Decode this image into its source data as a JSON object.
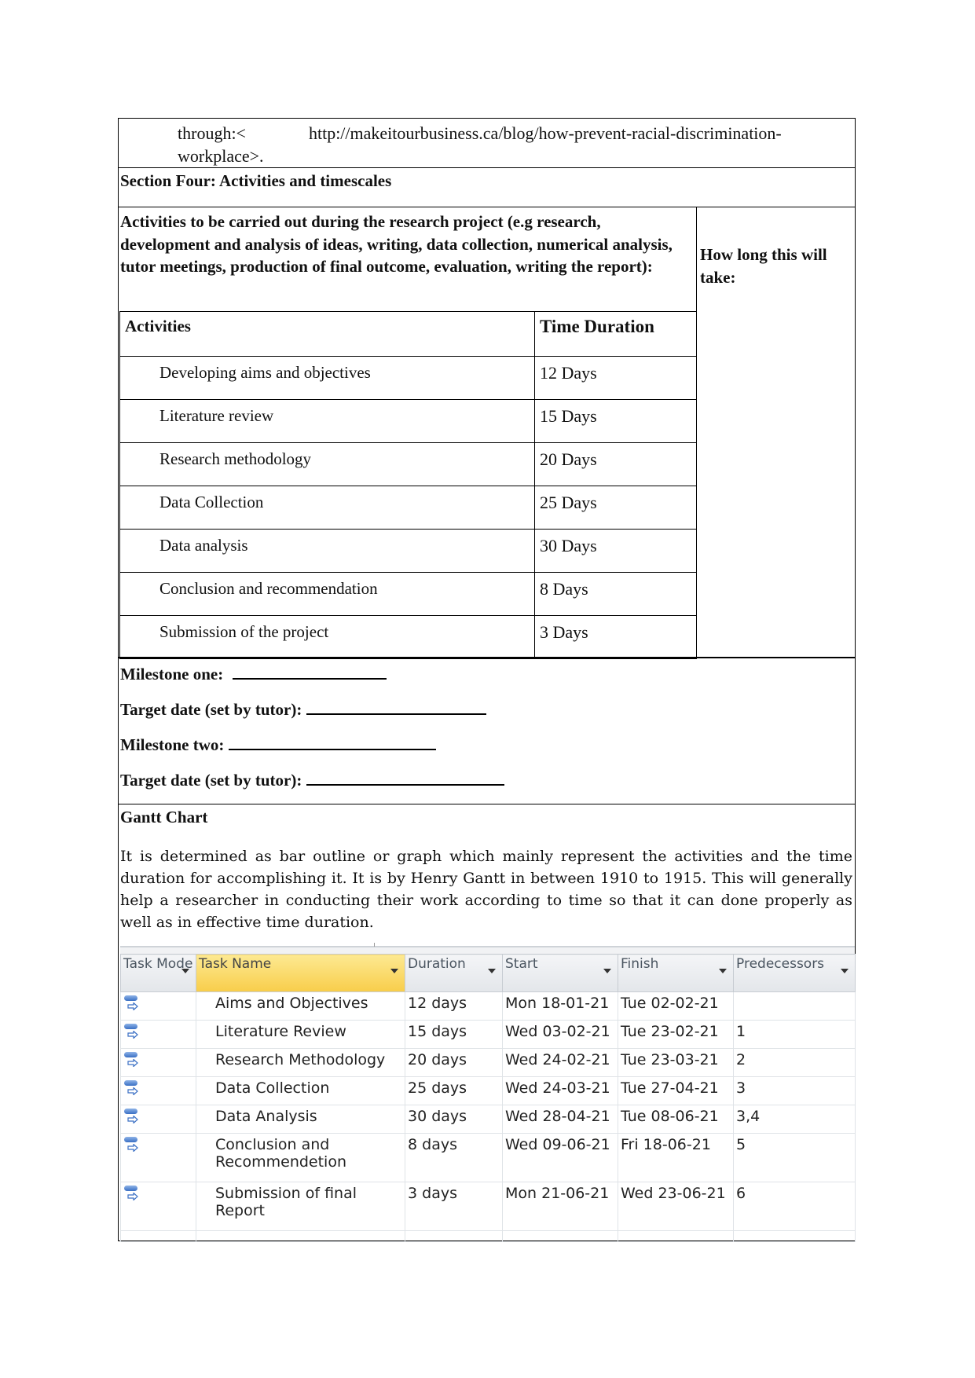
{
  "reference": {
    "prefix": "through:<",
    "url": "http://makeitourbusiness.ca/blog/how-prevent-racial-discrimination-",
    "suffix": "workplace>."
  },
  "section_title": "Section Four: Activities and timescales",
  "activities_block": {
    "intro": "Activities to be carried out during the research project (e.g research, development and analysis of ideas, writing, data collection, numerical analysis, tutor meetings, production of final outcome, evaluation, writing the report):",
    "how_long_label": "How long this will take:",
    "table": {
      "headers": [
        "Activities",
        "Time Duration"
      ],
      "rows": [
        {
          "activity": "Developing aims and objectives",
          "duration": "12 Days"
        },
        {
          "activity": "Literature review",
          "duration": "15 Days"
        },
        {
          "activity": "Research methodology",
          "duration": "20 Days"
        },
        {
          "activity": "Data Collection",
          "duration": "25 Days"
        },
        {
          "activity": "Data analysis",
          "duration": "30 Days"
        },
        {
          "activity": "Conclusion and recommendation",
          "duration": "8 Days"
        },
        {
          "activity": "Submission of the project",
          "duration": "3 Days"
        }
      ]
    }
  },
  "milestones": [
    {
      "label": "Milestone one:",
      "value": ""
    },
    {
      "label": "Target date (set by tutor):",
      "value": ""
    },
    {
      "label": "Milestone two:",
      "value": ""
    },
    {
      "label": "Target date (set by tutor):",
      "value": ""
    }
  ],
  "gantt": {
    "title": "Gantt Chart",
    "paragraph": " It is determined as bar outline or graph which mainly represent the activities and the time duration for accomplishing it. It is by Henry Gantt in between 1910 to 1915. This will generally help a researcher in conducting their work according to time so that it can done properly as well as in effective time duration.",
    "table": {
      "headers": [
        "Task Mode",
        "Task Name",
        "Duration",
        "Start",
        "Finish",
        "Predecessors"
      ],
      "selected_header": "Task Name",
      "task_mode_icon": "auto-scheduled-task-icon",
      "colors": {
        "selected_header": "#f8cd4a",
        "header": "#e3e6ea",
        "icon": "#3a6fc4"
      },
      "rows": [
        {
          "name": "Aims and Objectives",
          "duration": "12 days",
          "start": "Mon 18-01-21",
          "finish": "Tue 02-02-21",
          "predecessors": ""
        },
        {
          "name": "Literature Review",
          "duration": "15 days",
          "start": "Wed 03-02-21",
          "finish": "Tue 23-02-21",
          "predecessors": "1"
        },
        {
          "name": "Research Methodology",
          "duration": "20 days",
          "start": "Wed 24-02-21",
          "finish": "Tue 23-03-21",
          "predecessors": "2"
        },
        {
          "name": "Data Collection",
          "duration": "25 days",
          "start": "Wed 24-03-21",
          "finish": "Tue 27-04-21",
          "predecessors": "3"
        },
        {
          "name": "Data Analysis",
          "duration": "30 days",
          "start": "Wed 28-04-21",
          "finish": "Tue 08-06-21",
          "predecessors": "3,4"
        },
        {
          "name": "Conclusion and Recommendetion",
          "duration": "8 days",
          "start": "Wed 09-06-21",
          "finish": "Fri 18-06-21",
          "predecessors": "5"
        },
        {
          "name": "Submission of final Report",
          "duration": "3 days",
          "start": "Mon 21-06-21",
          "finish": "Wed 23-06-21",
          "predecessors": "6"
        }
      ]
    }
  }
}
